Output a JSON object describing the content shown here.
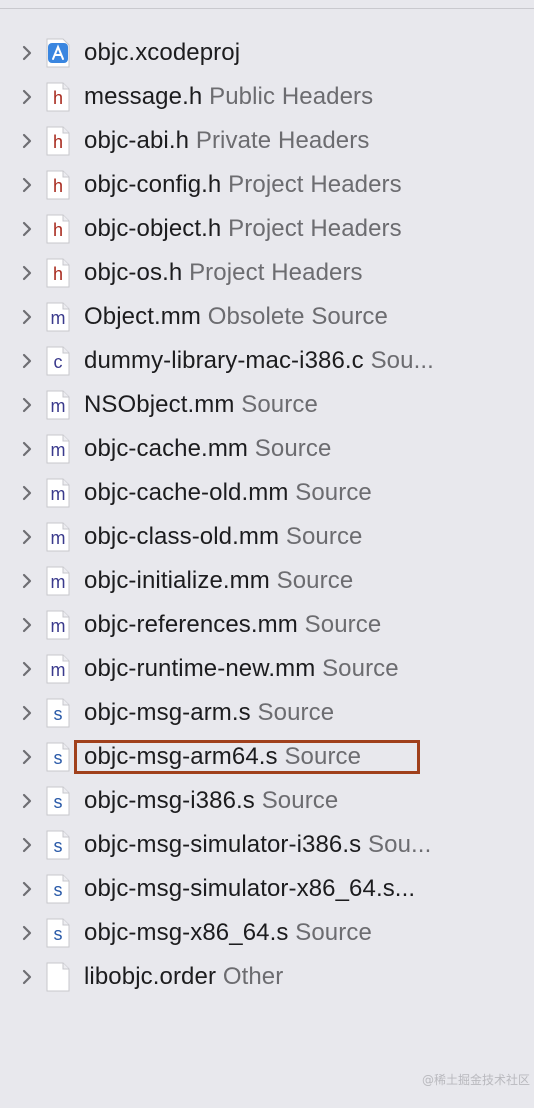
{
  "colors": {
    "highlight_border": "#a0401c",
    "header_icon_letter": "#a82a1e",
    "source_icon_letter": "#3a3a8c",
    "asm_icon_letter": "#2a5aa8",
    "project_icon": "#3a86e0"
  },
  "files": [
    {
      "name": "objc.xcodeproj",
      "group": "",
      "icon": "xcodeproj-icon",
      "letter": "",
      "highlighted": false
    },
    {
      "name": "message.h",
      "group": "Public Headers",
      "icon": "header-file-icon",
      "letter": "h",
      "highlighted": false
    },
    {
      "name": "objc-abi.h",
      "group": "Private Headers",
      "icon": "header-file-icon",
      "letter": "h",
      "highlighted": false
    },
    {
      "name": "objc-config.h",
      "group": "Project Headers",
      "icon": "header-file-icon",
      "letter": "h",
      "highlighted": false
    },
    {
      "name": "objc-object.h",
      "group": "Project Headers",
      "icon": "header-file-icon",
      "letter": "h",
      "highlighted": false
    },
    {
      "name": "objc-os.h",
      "group": "Project Headers",
      "icon": "header-file-icon",
      "letter": "h",
      "highlighted": false
    },
    {
      "name": "Object.mm",
      "group": "Obsolete Source",
      "icon": "objcpp-file-icon",
      "letter": "m",
      "highlighted": false
    },
    {
      "name": "dummy-library-mac-i386.c",
      "group": "Sou...",
      "icon": "c-file-icon",
      "letter": "c",
      "highlighted": false
    },
    {
      "name": "NSObject.mm",
      "group": "Source",
      "icon": "objcpp-file-icon",
      "letter": "m",
      "highlighted": false
    },
    {
      "name": "objc-cache.mm",
      "group": "Source",
      "icon": "objcpp-file-icon",
      "letter": "m",
      "highlighted": false
    },
    {
      "name": "objc-cache-old.mm",
      "group": "Source",
      "icon": "objcpp-file-icon",
      "letter": "m",
      "highlighted": false
    },
    {
      "name": "objc-class-old.mm",
      "group": "Source",
      "icon": "objcpp-file-icon",
      "letter": "m",
      "highlighted": false
    },
    {
      "name": "objc-initialize.mm",
      "group": "Source",
      "icon": "objcpp-file-icon",
      "letter": "m",
      "highlighted": false
    },
    {
      "name": "objc-references.mm",
      "group": "Source",
      "icon": "objcpp-file-icon",
      "letter": "m",
      "highlighted": false
    },
    {
      "name": "objc-runtime-new.mm",
      "group": "Source",
      "icon": "objcpp-file-icon",
      "letter": "m",
      "highlighted": false
    },
    {
      "name": "objc-msg-arm.s",
      "group": "Source",
      "icon": "assembly-file-icon",
      "letter": "s",
      "highlighted": false
    },
    {
      "name": "objc-msg-arm64.s",
      "group": "Source",
      "icon": "assembly-file-icon",
      "letter": "s",
      "highlighted": true
    },
    {
      "name": "objc-msg-i386.s",
      "group": "Source",
      "icon": "assembly-file-icon",
      "letter": "s",
      "highlighted": false
    },
    {
      "name": "objc-msg-simulator-i386.s",
      "group": "Sou...",
      "icon": "assembly-file-icon",
      "letter": "s",
      "highlighted": false
    },
    {
      "name": "objc-msg-simulator-x86_64.s...",
      "group": "",
      "icon": "assembly-file-icon",
      "letter": "s",
      "highlighted": false
    },
    {
      "name": "objc-msg-x86_64.s",
      "group": "Source",
      "icon": "assembly-file-icon",
      "letter": "s",
      "highlighted": false
    },
    {
      "name": "libobjc.order",
      "group": "Other",
      "icon": "plain-file-icon",
      "letter": "",
      "highlighted": false
    }
  ],
  "watermark": "@稀土掘金技术社区"
}
